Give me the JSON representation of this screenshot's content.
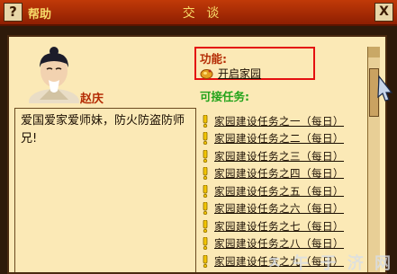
{
  "titlebar": {
    "help_icon_glyph": "?",
    "help_label": "帮助",
    "title": "交  谈",
    "close_glyph": "X"
  },
  "npc": {
    "name": "赵庆",
    "dialogue": "爱国爱家爱师妹，防火防盗防师兄!"
  },
  "functions": {
    "title": "功能:",
    "items": [
      {
        "label": "开启家园",
        "icon": "gourd-icon"
      }
    ]
  },
  "tasks": {
    "title": "可接任务:",
    "items": [
      "家园建设任务之一（每日）",
      "家园建设任务之二（每日）",
      "家园建设任务之三（每日）",
      "家园建设任务之四（每日）",
      "家园建设任务之五（每日）",
      "家园建设任务之六（每日）",
      "家园建设任务之七（每日）",
      "家园建设任务之八（每日）",
      "家园建设任务之九（每日）"
    ]
  },
  "watermark": "ㅈ 午 于 济 网",
  "colors": {
    "title_bar": "#b2300a",
    "panel": "#fbe9b6",
    "accent_red": "#e41010",
    "section_green": "#22a31a",
    "task_icon": "#f2c400"
  }
}
